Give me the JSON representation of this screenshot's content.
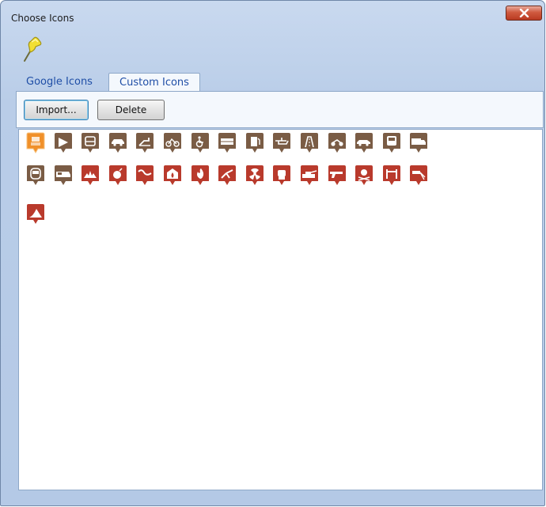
{
  "window": {
    "title": "Choose Icons"
  },
  "tabs": [
    {
      "label": "Google Icons",
      "active": false
    },
    {
      "label": "Custom Icons",
      "active": true
    }
  ],
  "toolbar": {
    "import_label": "Import...",
    "delete_label": "Delete"
  },
  "colors": {
    "brown_marker": "#7a5c45",
    "red_marker": "#b93a2c",
    "selected_marker": "#f0902a",
    "window_frame": "#b9cde8",
    "tab_text": "#1f4ea6"
  },
  "icons": [
    {
      "name": "selected-icon",
      "color": "orange",
      "selected": true
    },
    {
      "name": "airplane-icon",
      "color": "brown"
    },
    {
      "name": "bus-icon",
      "color": "brown"
    },
    {
      "name": "car-icon",
      "color": "brown"
    },
    {
      "name": "escalator-icon",
      "color": "brown"
    },
    {
      "name": "bicycle-icon",
      "color": "brown"
    },
    {
      "name": "wheelchair-icon",
      "color": "brown"
    },
    {
      "name": "train-icon",
      "color": "brown"
    },
    {
      "name": "gas-station-icon",
      "color": "brown"
    },
    {
      "name": "helicopter-icon",
      "color": "brown"
    },
    {
      "name": "road-icon",
      "color": "brown"
    },
    {
      "name": "motorcycle-icon",
      "color": "brown"
    },
    {
      "name": "car-side-icon",
      "color": "brown"
    },
    {
      "name": "tram-icon",
      "color": "brown"
    },
    {
      "name": "truck-icon",
      "color": "brown"
    },
    {
      "name": "subway-icon",
      "color": "brown"
    },
    {
      "name": "van-icon",
      "color": "brown"
    },
    {
      "name": "explosion-icon",
      "color": "red"
    },
    {
      "name": "bomb-icon",
      "color": "red"
    },
    {
      "name": "snake-icon",
      "color": "red"
    },
    {
      "name": "house-fire-icon",
      "color": "red"
    },
    {
      "name": "fire-icon",
      "color": "red"
    },
    {
      "name": "plane-crash-icon",
      "color": "red"
    },
    {
      "name": "radiation-icon",
      "color": "red"
    },
    {
      "name": "fist-icon",
      "color": "red"
    },
    {
      "name": "tank-icon",
      "color": "red"
    },
    {
      "name": "gun-icon",
      "color": "red"
    },
    {
      "name": "skull-crossbones-icon",
      "color": "red"
    },
    {
      "name": "torture-icon",
      "color": "red"
    },
    {
      "name": "water-cannon-icon",
      "color": "red"
    },
    {
      "name": "shark-icon",
      "color": "red"
    }
  ]
}
